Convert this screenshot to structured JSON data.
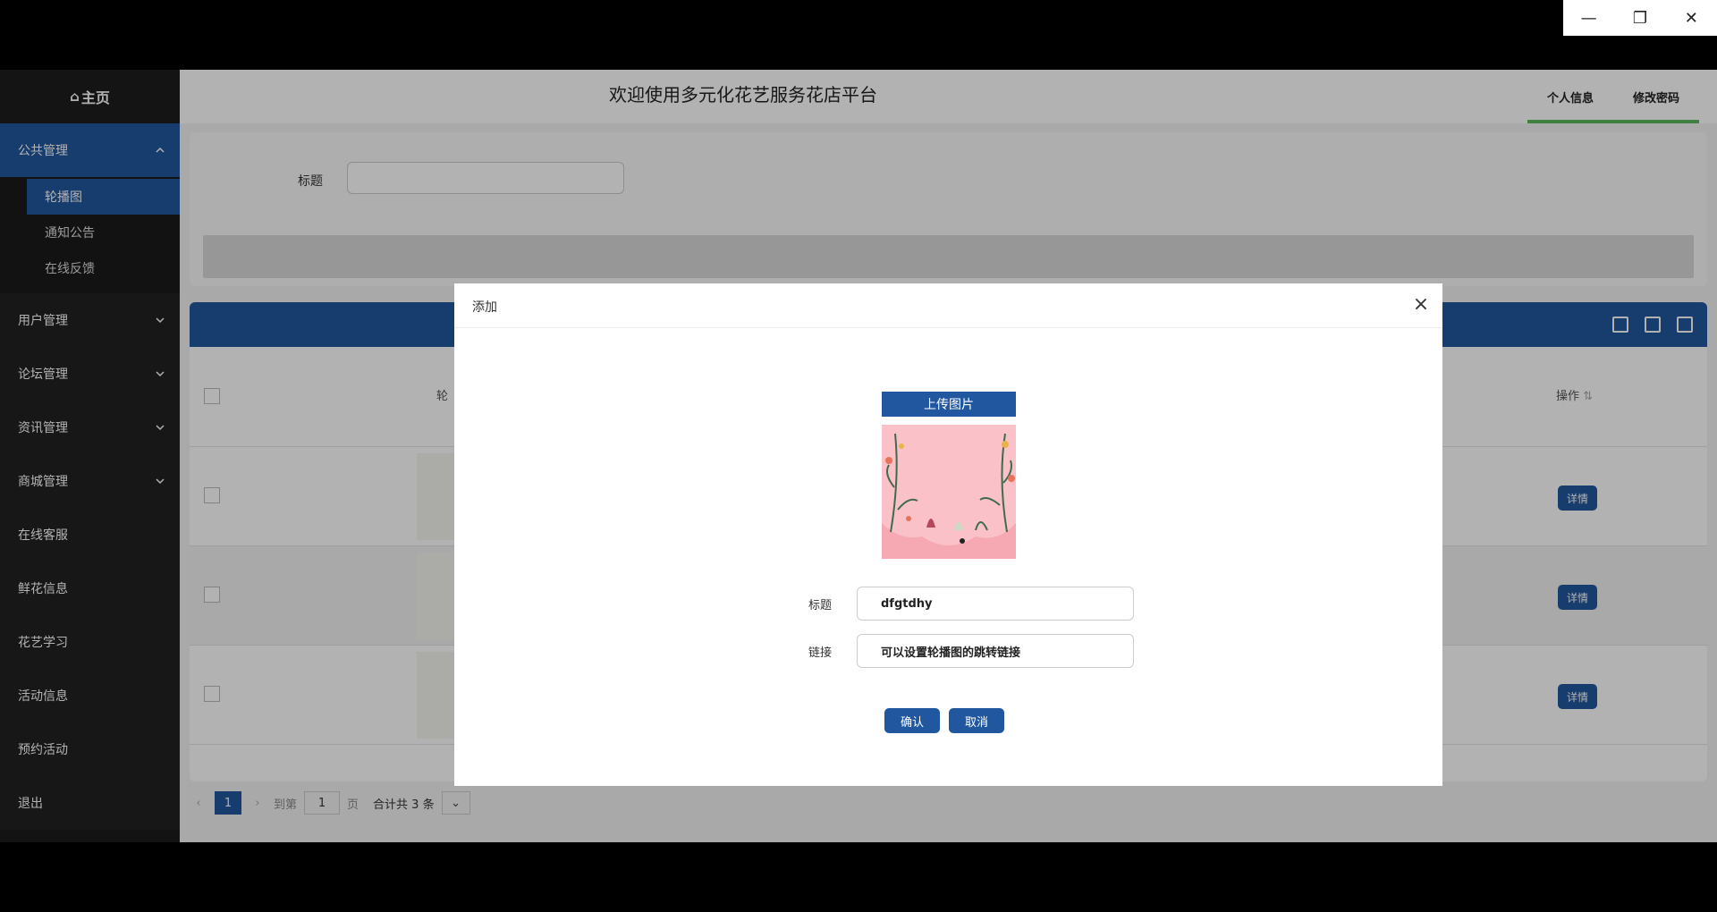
{
  "window": {
    "minimize_glyph": "—",
    "restore_glyph": "❐",
    "close_glyph": "✕"
  },
  "sidebar": {
    "home_label": "主页",
    "groups": [
      {
        "label": "公共管理",
        "expanded": true,
        "items": [
          "轮播图",
          "通知公告",
          "在线反馈"
        ]
      },
      {
        "label": "用户管理"
      },
      {
        "label": "论坛管理"
      },
      {
        "label": "资讯管理"
      },
      {
        "label": "商城管理"
      }
    ],
    "plain_items": [
      "在线客服",
      "鲜花信息",
      "花艺学习",
      "活动信息",
      "预约活动",
      "退出"
    ]
  },
  "header": {
    "site_title": "欢迎使用多元化花艺服务花店平台",
    "personal_info": "个人信息",
    "change_password": "修改密码",
    "accent_color": "#5cb85c"
  },
  "search": {
    "title_label": "标题"
  },
  "table": {
    "column_carousel": "轮",
    "column_actions": "操作",
    "detail_label": "详情",
    "row_count": 3
  },
  "pager": {
    "current_page": "1",
    "goto_label": "到第",
    "goto_value": "1",
    "page_unit": "页",
    "total_text": "合计共 3 条"
  },
  "dialog": {
    "title": "添加",
    "upload_label": "上传图片",
    "title_field_label": "标题",
    "title_field_value": "dfgtdhy",
    "link_field_label": "链接",
    "link_field_value": "可以设置轮播图的跳转链接",
    "confirm_label": "确认",
    "cancel_label": "取消"
  },
  "colors": {
    "primary": "#21579e",
    "sidebar_bg": "#1c1c1c"
  }
}
